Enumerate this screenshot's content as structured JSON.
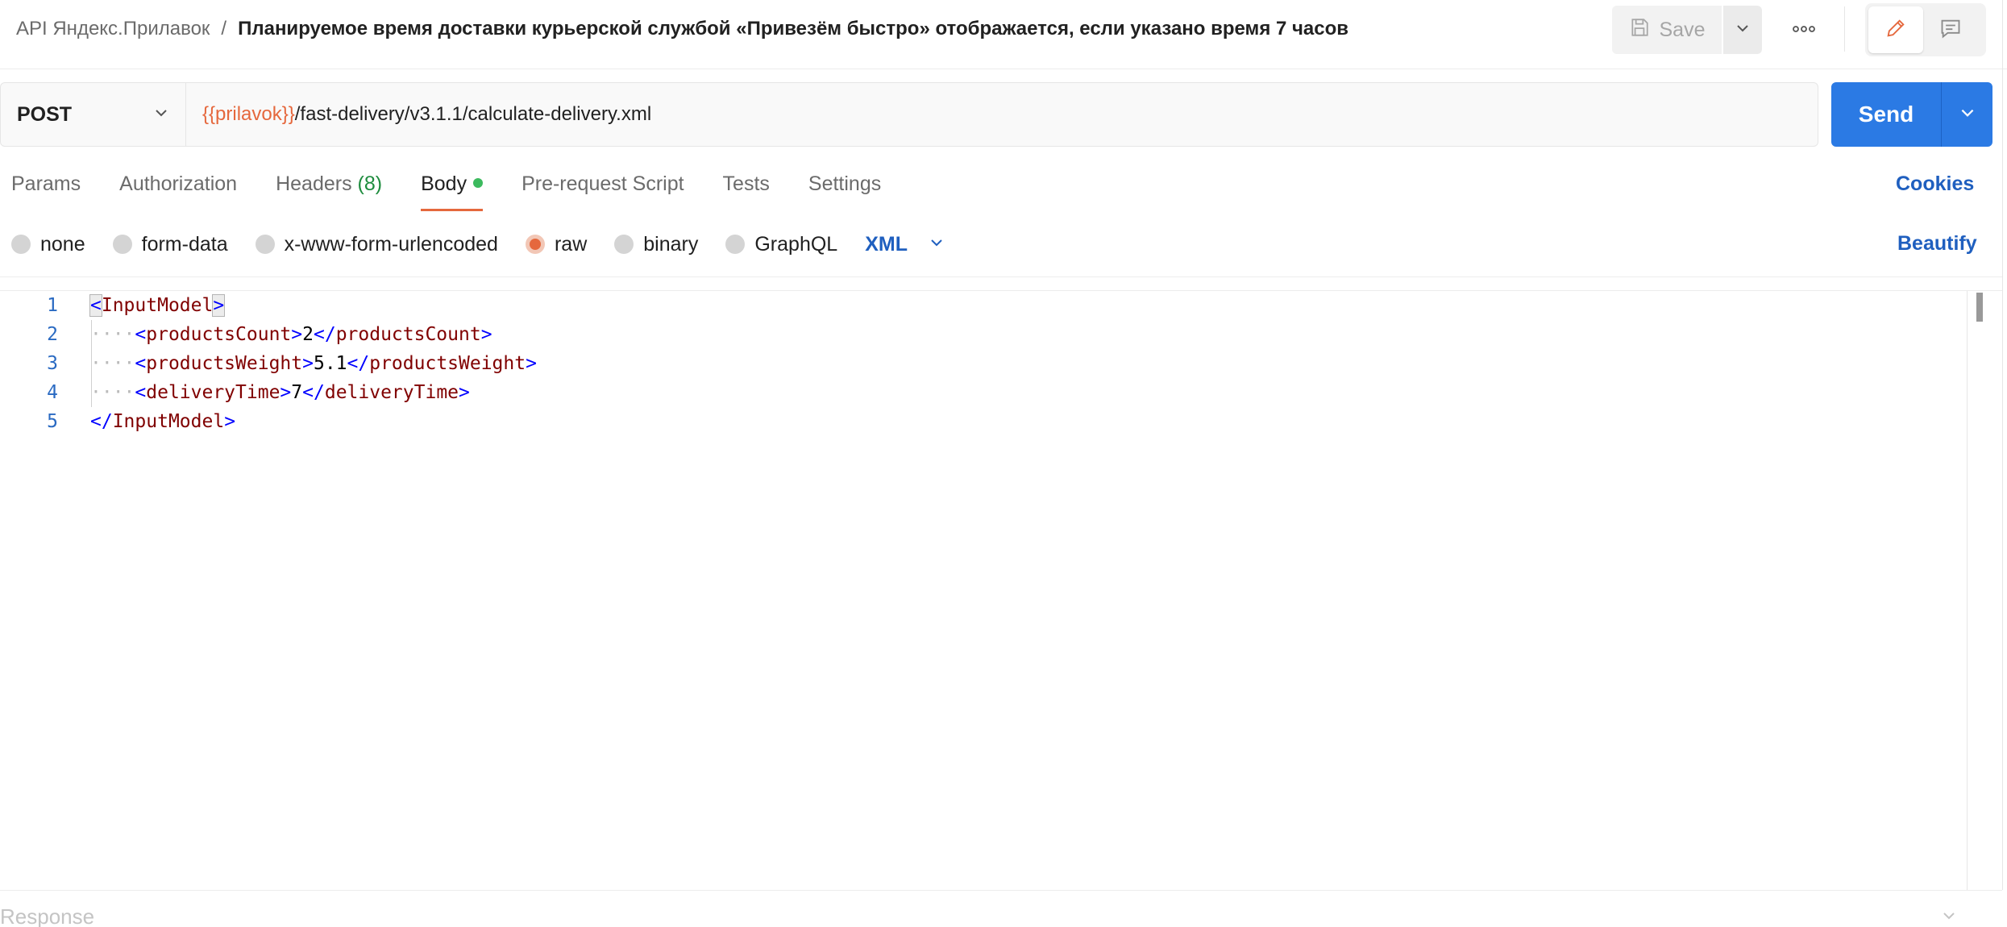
{
  "header": {
    "breadcrumb_parent": "API Яндекс.Прилавок",
    "breadcrumb_separator": "/",
    "request_title": "Планируемое время доставки курьерской службой «Привезём быстро» отображается, если указано время 7 часов",
    "save_label": "Save",
    "save_icon": "floppy-disk-icon",
    "more_icon": "ellipsis-icon",
    "edit_icon": "pencil-icon",
    "comments_icon": "comment-icon"
  },
  "request": {
    "method": "POST",
    "url_variable": "{{prilavok}}",
    "url_path": "/fast-delivery/v3.1.1/calculate-delivery.xml",
    "send_label": "Send"
  },
  "tabs": [
    {
      "label": "Params"
    },
    {
      "label": "Authorization"
    },
    {
      "label": "Headers",
      "count": "(8)"
    },
    {
      "label": "Body",
      "active": true
    },
    {
      "label": "Pre-request Script"
    },
    {
      "label": "Tests"
    },
    {
      "label": "Settings"
    }
  ],
  "cookies_label": "Cookies",
  "body_options": [
    {
      "label": "none",
      "checked": false
    },
    {
      "label": "form-data",
      "checked": false
    },
    {
      "label": "x-www-form-urlencoded",
      "checked": false
    },
    {
      "label": "raw",
      "checked": true
    },
    {
      "label": "binary",
      "checked": false
    },
    {
      "label": "GraphQL",
      "checked": false
    }
  ],
  "body_format": "XML",
  "beautify_label": "Beautify",
  "editor": {
    "line_numbers": [
      "1",
      "2",
      "3",
      "4",
      "5"
    ],
    "lines": [
      {
        "indent": "",
        "open": "<",
        "tag": "InputModel",
        "close": ">",
        "value": "",
        "end_open": "",
        "end_tag": "",
        "end_close": ""
      },
      {
        "indent": "····",
        "open": "<",
        "tag": "productsCount",
        "close": ">",
        "value": "2",
        "end_open": "</",
        "end_tag": "productsCount",
        "end_close": ">"
      },
      {
        "indent": "····",
        "open": "<",
        "tag": "productsWeight",
        "close": ">",
        "value": "5.1",
        "end_open": "</",
        "end_tag": "productsWeight",
        "end_close": ">"
      },
      {
        "indent": "····",
        "open": "<",
        "tag": "deliveryTime",
        "close": ">",
        "value": "7",
        "end_open": "</",
        "end_tag": "deliveryTime",
        "end_close": ">"
      },
      {
        "indent": "",
        "open": "</",
        "tag": "InputModel",
        "close": ">",
        "value": "",
        "end_open": "",
        "end_tag": "",
        "end_close": ""
      }
    ]
  },
  "response_label": "Response",
  "colors": {
    "accent": "#e5683d",
    "primary": "#2b7ae4",
    "link": "#1f5fbf",
    "xml_bracket": "#0000ff",
    "xml_tag": "#800000"
  }
}
